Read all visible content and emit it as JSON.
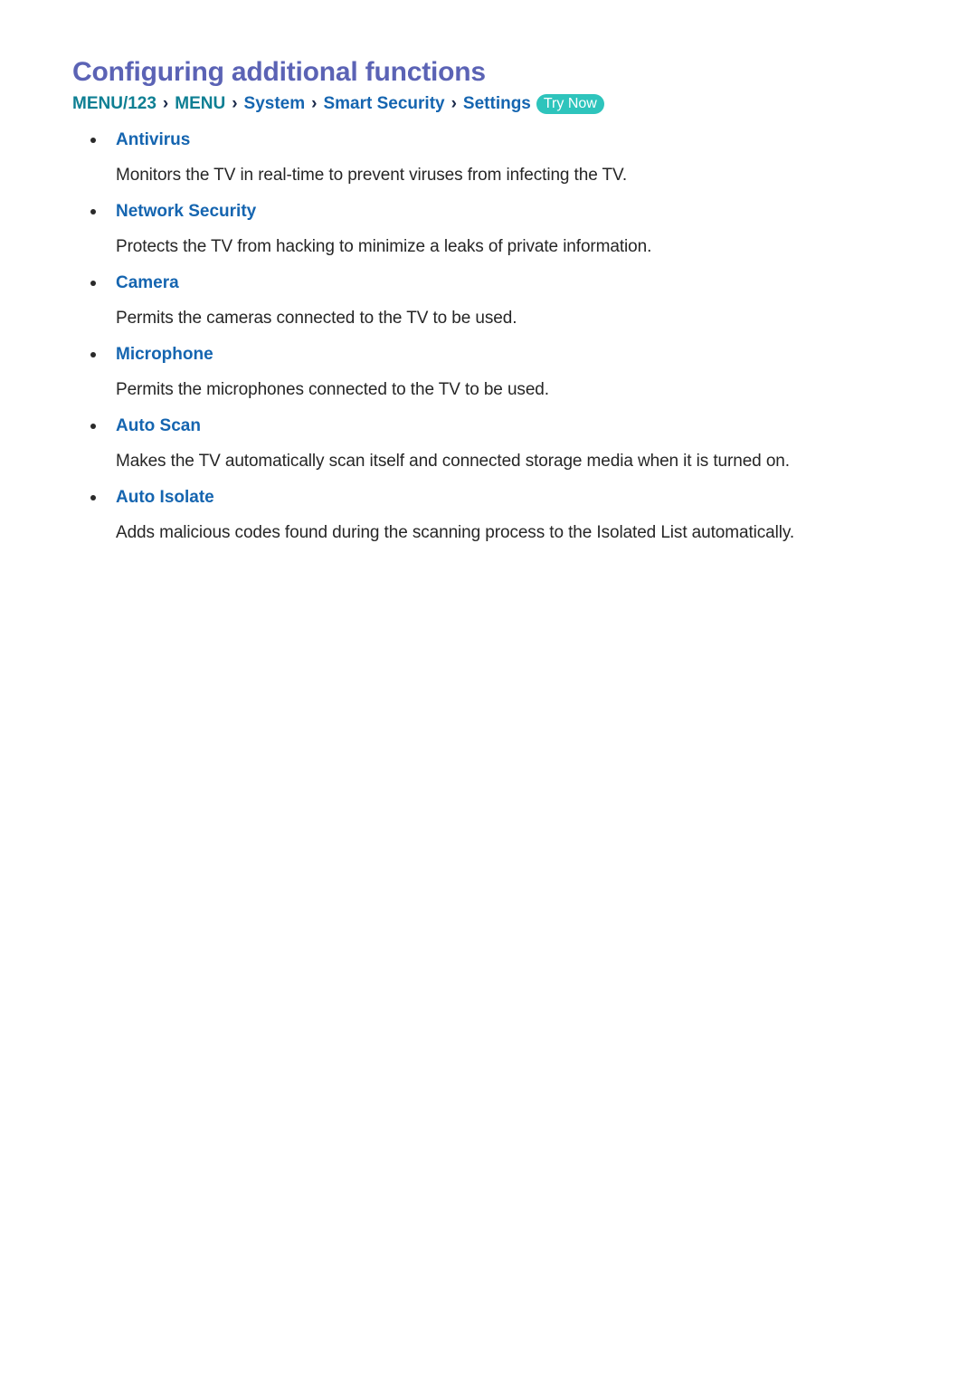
{
  "page": {
    "title": "Configuring additional functions",
    "title_color": "#5b63b5",
    "background": "#ffffff"
  },
  "breadcrumb": {
    "separator": "›",
    "items": [
      {
        "label": "MENU/123",
        "color": "#0e7f93"
      },
      {
        "label": "MENU",
        "color": "#0e7f93"
      },
      {
        "label": "System",
        "color": "#1565b0"
      },
      {
        "label": "Smart Security",
        "color": "#1565b0"
      },
      {
        "label": "Settings",
        "color": "#1565b0"
      }
    ],
    "badge": {
      "label": "Try Now",
      "background": "#2ec4bc",
      "text_color": "#ffffff"
    }
  },
  "sections": [
    {
      "heading": "Antivirus",
      "description": "Monitors the TV in real-time to prevent viruses from infecting the TV."
    },
    {
      "heading": "Network Security",
      "description": "Protects the TV from hacking to minimize a leaks of private information."
    },
    {
      "heading": "Camera",
      "description": "Permits the cameras connected to the TV to be used."
    },
    {
      "heading": "Microphone",
      "description": "Permits the microphones connected to the TV to be used."
    },
    {
      "heading": "Auto Scan",
      "description": "Makes the TV automatically scan itself and connected storage media when it is turned on."
    },
    {
      "heading": "Auto Isolate",
      "description": "Adds malicious codes found during the scanning process to the Isolated List automatically."
    }
  ],
  "colors": {
    "heading_blue": "#1565b0",
    "breadcrumb_teal": "#0e7f93",
    "body_text": "#262626",
    "accent_teal": "#2ec4bc",
    "title_purple": "#5b63b5"
  }
}
